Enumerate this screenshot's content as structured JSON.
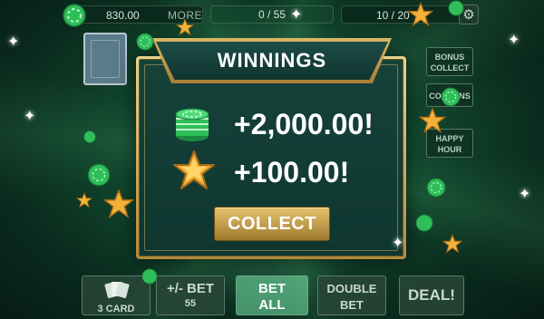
{
  "top_bar": {
    "balance": "830.00",
    "more_label": "MORE",
    "hands": "0 / 55",
    "xp": "10 / 20"
  },
  "side_buttons": {
    "bonus_line1": "BONUS",
    "bonus_line2": "COLLECT",
    "coupons": "COUPONS",
    "happy_line1": "HAPPY",
    "happy_line2": "HOUR"
  },
  "modal": {
    "title": "WINNINGS",
    "chips_prize": "+2,000.00!",
    "stars_prize": "+100.00!",
    "collect_label": "COLLECT"
  },
  "bottom_bar": {
    "three_card": "3 CARD",
    "bet_label": "+/- BET",
    "bet_value": "55",
    "bet_all_line1": "BET",
    "bet_all_line2": "ALL",
    "double_line1": "DOUBLE",
    "double_line2": "BET",
    "deal_label": "DEAL!"
  },
  "colors": {
    "gold": "#d9b865",
    "chip_green": "#2fbf5a",
    "star_gold": "#f2b13a",
    "background_green": "#124a30"
  },
  "icons": [
    "chip-icon",
    "star-icon",
    "gear-icon",
    "cards-icon"
  ]
}
